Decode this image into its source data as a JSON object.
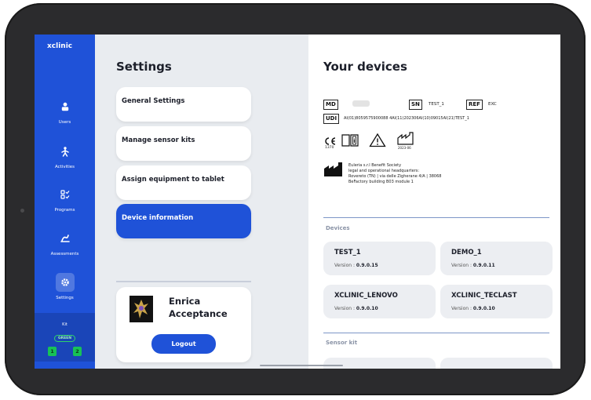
{
  "app": {
    "brand": "xclinic"
  },
  "nav": {
    "items": [
      {
        "label": "Users",
        "icon": "user-icon"
      },
      {
        "label": "Activities",
        "icon": "activities-icon"
      },
      {
        "label": "Programs",
        "icon": "programs-icon"
      },
      {
        "label": "Assessments",
        "icon": "assessments-icon"
      },
      {
        "label": "Settings",
        "icon": "gear-icon",
        "active": true
      }
    ],
    "kit": {
      "label": "Kit",
      "badge": "GREEN",
      "nums": [
        "1",
        "2"
      ]
    }
  },
  "settings": {
    "title": "Settings",
    "menu": [
      {
        "label": "General Settings"
      },
      {
        "label": "Manage sensor kits"
      },
      {
        "label": "Assign equipment to tablet"
      },
      {
        "label": "Device information",
        "active": true
      }
    ],
    "profile": {
      "name_line1": "Enrica",
      "name_line2": "Acceptance",
      "logout_label": "Logout"
    }
  },
  "devices": {
    "title": "Your devices",
    "label": {
      "md": "MD",
      "sn": "SN",
      "sn_value": "TEST_1",
      "ref": "REF",
      "ref_value": "EXC",
      "udi": "UDI",
      "udi_value": "AI(01)8059575900088 4AI(11)202306AI(10)09015AI(21)TEST_1",
      "ce_number": "1370",
      "date": "2023-06",
      "manufacturer": [
        "Euleria s.r.l Benefit Society",
        "legal and operational headquarters:",
        "Rovereto (TN) | via delle Zigherane 4/A | 38068",
        "BeFactory building B03 module 1"
      ]
    },
    "sections": {
      "devices": "Devices",
      "sensor_kit": "Sensor kit"
    },
    "version_prefix": "Version :",
    "list": [
      {
        "name": "TEST_1",
        "version": "0.9.0.15"
      },
      {
        "name": "DEMO_1",
        "version": "0.9.0.11"
      },
      {
        "name": "XCLINIC_LENOVO",
        "version": "0.9.0.10"
      },
      {
        "name": "XCLINIC_TECLAST",
        "version": "0.9.0.10"
      }
    ]
  },
  "colors": {
    "primary": "#1f52d8",
    "kit_green": "#17c257"
  }
}
